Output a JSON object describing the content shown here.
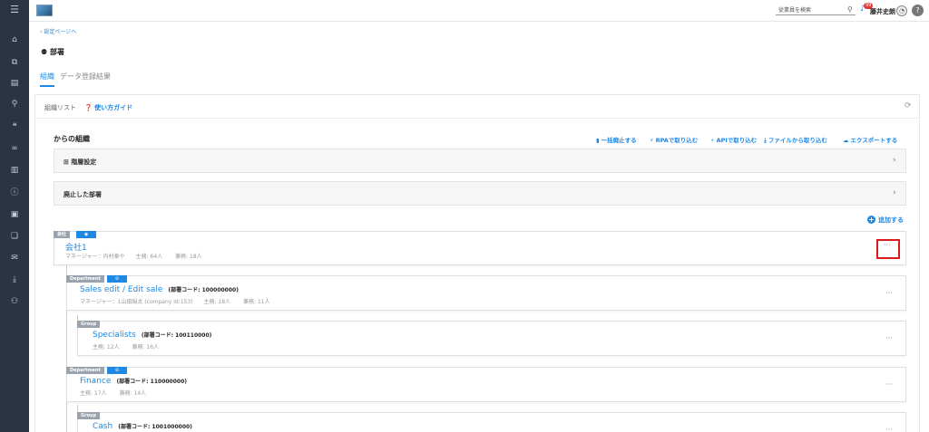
{
  "header": {
    "search_placeholder": "従業員を検索",
    "notification_count": "99",
    "user_name": "藤井史朗"
  },
  "breadcrumb": {
    "back_label": "設定ページへ"
  },
  "page": {
    "title": "部署"
  },
  "tabs": [
    {
      "label": "組織",
      "active": true
    },
    {
      "label": "データ登録結果",
      "active": false
    }
  ],
  "panel": {
    "title": "組織リスト",
    "guide_label": "使い方ガイド",
    "section_title": "からの組織",
    "actions": [
      {
        "label": "一括廃止する",
        "icon": "trash-icon"
      },
      {
        "label": "RPAで取り込む",
        "icon": "plug-icon"
      },
      {
        "label": "APIで取り込む",
        "icon": "plug-icon"
      },
      {
        "label": "ファイルから取り込む",
        "icon": "download-icon"
      },
      {
        "label": "エクスポートする",
        "icon": "cloud-download-icon"
      }
    ],
    "collapsibles": [
      {
        "label": "階層設定"
      },
      {
        "label": "廃止した部署"
      }
    ],
    "add_label": "追加する"
  },
  "org": {
    "company": {
      "tag": "会社",
      "name": "会社1",
      "meta": "マネージャー：内村泰や　　主務: 64人 　　兼務: 18人"
    },
    "departments": [
      {
        "tag": "Department",
        "name": "Sales edit / Edit sale",
        "code": "(部署コード: 100000000)",
        "meta": "マネージャー：1山田絹太 (company id:153)　　主務: 18人 　　兼務: 11人"
      },
      {
        "tag": "Group",
        "name": "Specialists",
        "code": "(部署コード: 100110000)",
        "meta": "主務: 12人 　　兼務: 16人"
      },
      {
        "tag": "Department",
        "name": "Finance",
        "code": "(部署コード: 110000000)",
        "meta": "主務: 17人 　　兼務: 14人"
      },
      {
        "tag": "Group",
        "name": "Cash",
        "code": "(部署コード: 1001000000)",
        "meta": ""
      }
    ],
    "more_label": "···"
  }
}
